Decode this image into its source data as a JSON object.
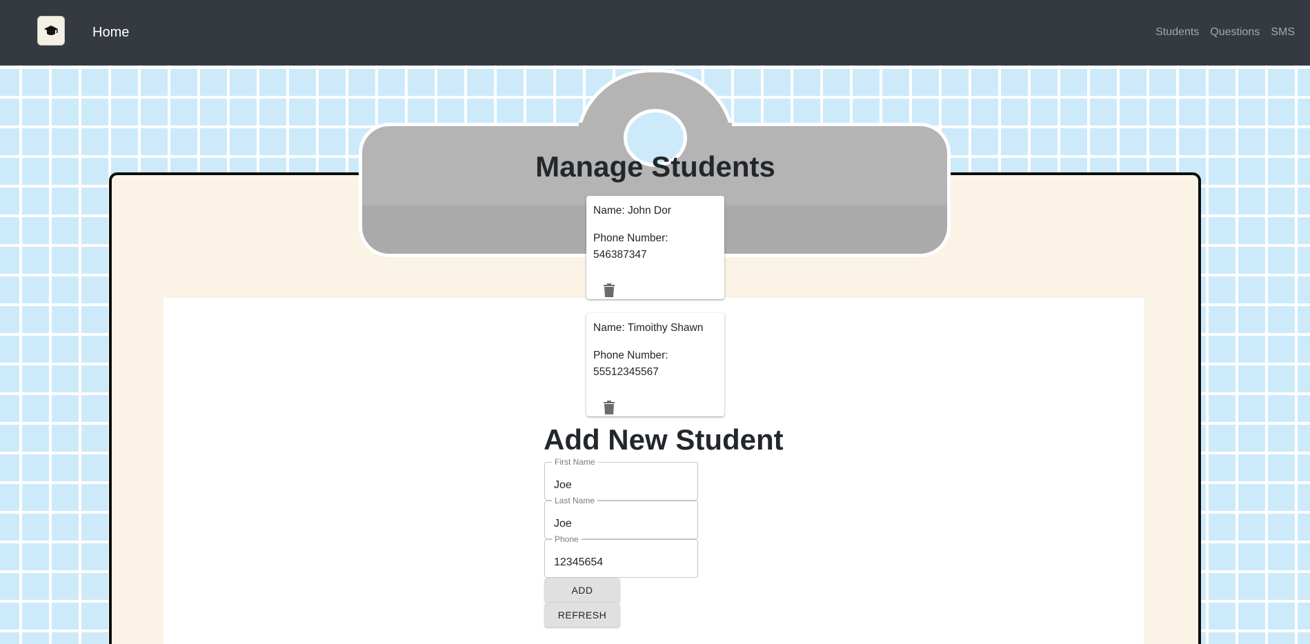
{
  "navbar": {
    "brand_icon": "graduation-cap-icon",
    "home_label": "Home",
    "links": [
      "Students",
      "Questions",
      "SMS"
    ]
  },
  "main": {
    "title": "Manage Students",
    "students": [
      {
        "name_line": "Name: John Dor",
        "phone_label": "Phone Number:",
        "phone": "546387347"
      },
      {
        "name_line": "Name: Timoithy Shawn",
        "phone_label": "Phone Number:",
        "phone": "55512345567"
      }
    ],
    "form": {
      "title": "Add New Student",
      "first_name_label": "First Name",
      "first_name_value": "Joe",
      "last_name_label": "Last Name",
      "last_name_value": "Joe",
      "phone_label": "Phone",
      "phone_value": "12345654",
      "add_label": "ADD",
      "refresh_label": "REFRESH"
    }
  },
  "colors": {
    "navbar": "#343a40",
    "background": "#cdeafb",
    "clipboard": "#faf3e6",
    "clip": "#b4b4b4"
  }
}
